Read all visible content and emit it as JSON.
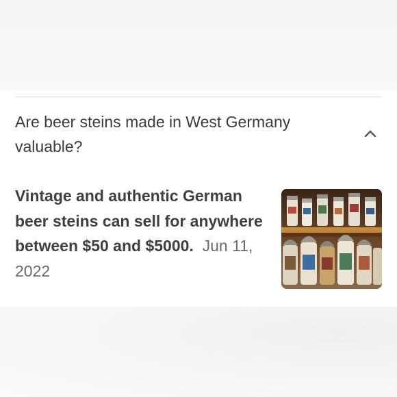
{
  "faq": {
    "question": "Are beer steins made in West Germany valuable?",
    "answer_bold": "Vintage and authentic German beer steins can sell for anywhere between $50 and $5000",
    "answer_punct": ".",
    "answer_date": "Jun 11, 2022",
    "expand_icon": "chevron-up-icon",
    "image_subject": "beer steins on shelves"
  },
  "colors": {
    "text": "#3b3b3b",
    "date": "#6a6a6a",
    "divider": "#dcdcdc",
    "card": "#ffffff"
  }
}
